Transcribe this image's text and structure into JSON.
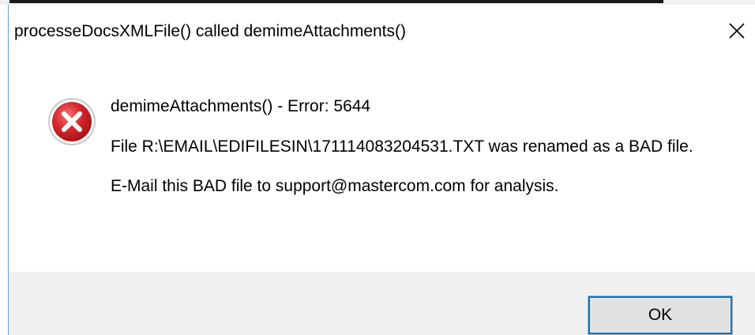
{
  "dialog": {
    "title": "processeDocsXMLFile() called demimeAttachments()",
    "close_icon": "close-icon",
    "icon": "error-icon",
    "message": {
      "heading": "demimeAttachments() - Error: 5644",
      "detail": "File R:\\EMAIL\\EDIFILESIN\\171114083204531.TXT was renamed as a BAD file.",
      "instruction": "E-Mail this BAD file to support@mastercom.com for analysis."
    },
    "ok_label": "OK"
  },
  "colors": {
    "error_red": "#d6262d",
    "footer_bg": "#f0f0f0",
    "button_bg": "#e1e1e1",
    "focus_blue": "#0078d7",
    "window_border": "#6d9bd1"
  }
}
